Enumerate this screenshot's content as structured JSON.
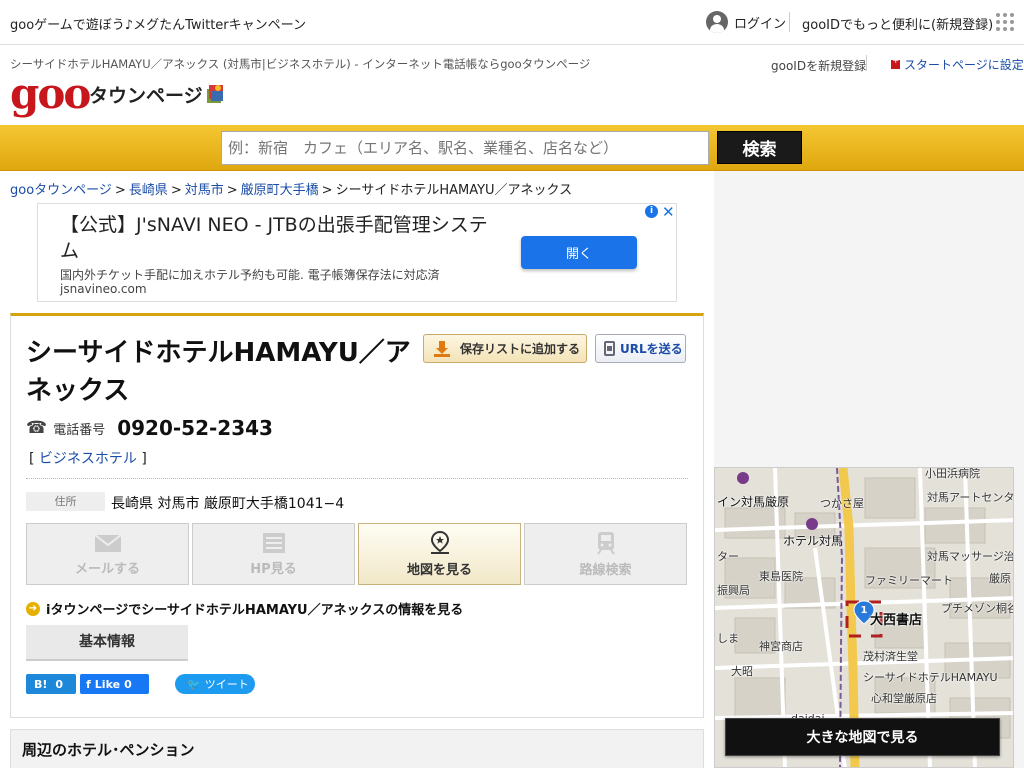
{
  "topbar": {
    "promo": "gooゲームで遊ぼう♪メグたんTwitterキャンペーン",
    "login": "ログイン",
    "register": "gooIDでもっと便利に(新規登録)"
  },
  "header": {
    "page_title": "シーサイドホテルHAMAYU／アネックス (対馬市|ビジネスホテル) - インターネット電話帳ならgooタウンページ",
    "logo": "goo",
    "logo_text": "タウンページ",
    "new_id": "gooIDを新規登録",
    "startpage": "スタートページに設定"
  },
  "search": {
    "placeholder": "例：新宿　カフェ（エリア名、駅名、業種名、店名など）",
    "button": "検索"
  },
  "breadcrumb": [
    {
      "label": "gooタウンページ"
    },
    {
      "label": "長崎県"
    },
    {
      "label": "対馬市"
    },
    {
      "label": "厳原町大手橋"
    },
    {
      "label": "シーサイドホテルHAMAYU／アネックス"
    }
  ],
  "ad": {
    "title": "【公式】J'sNAVI NEO - JTBの出張手配管理システム",
    "desc": "国内外チケット手配に加えホテル予約も可能. 電子帳簿保存法に対応済",
    "url": "jsnavineo.com",
    "button": "開く"
  },
  "listing": {
    "name": "シーサイドホテルHAMAYU／アネックス",
    "save_button": "保存リストに追加する",
    "url_button": "URLを送る",
    "tel_label": "電話番号",
    "tel": "0920-52-2343",
    "category": "ビジネスホテル",
    "address_label": "住所",
    "address": "長崎県 対馬市 厳原町大手橋1041−4",
    "actions": [
      {
        "label": "メールする",
        "icon": "mail-icon",
        "active": false
      },
      {
        "label": "HP見る",
        "icon": "web-icon",
        "active": false
      },
      {
        "label": "地図を見る",
        "icon": "map-pin-icon",
        "active": true
      },
      {
        "label": "路線検索",
        "icon": "train-icon",
        "active": false
      }
    ],
    "i_link": "iタウンページでシーサイドホテルHAMAYU／アネックスの情報を見る",
    "tab_basic": "基本情報",
    "hatena_count": "0",
    "fb_label": "Like",
    "fb_count": "0",
    "tweet": "ツイート"
  },
  "nearby": {
    "title": "周辺のホテル･ペンション"
  },
  "map": {
    "labels": {
      "l1": "イン対馬厳原",
      "l2": "小田浜病院",
      "l3": "つかさ屋",
      "l4": "対馬アートセンタ",
      "l5": "ホテル対馬",
      "l6": "対馬マッサージ治",
      "l7": "ター",
      "l8": "東島医院",
      "l9": "ファミリーマート",
      "l10": "厳原",
      "l11": "振興局",
      "l12": "大西書店",
      "l13": "プチメゾン桐谷",
      "l14": "しま",
      "l15": "神宮商店",
      "l16": "茂村済生堂",
      "l17": "大昭",
      "l18": "シーサイドホテルHAMAYU",
      "l19": "心和堂厳原店",
      "l20": "daidai"
    },
    "marker": "1",
    "button": "大きな地図で見る"
  }
}
